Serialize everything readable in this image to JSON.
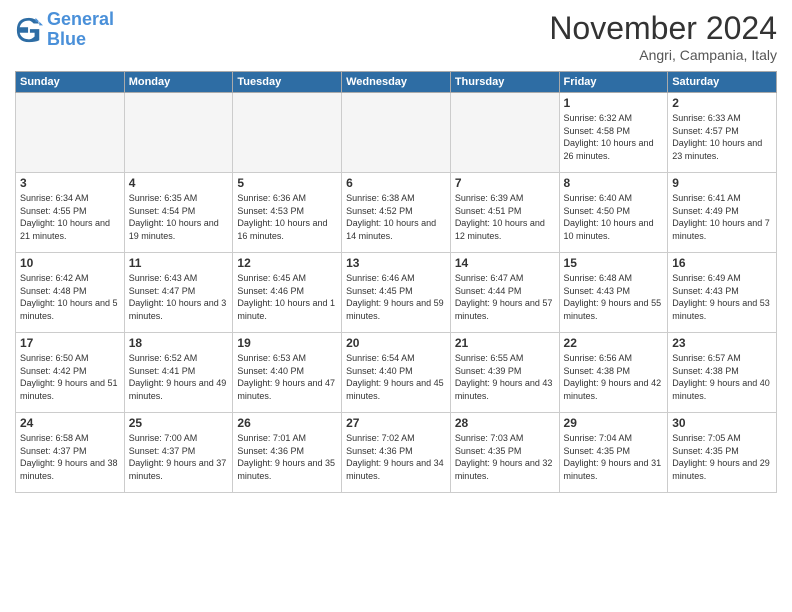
{
  "header": {
    "logo_general": "General",
    "logo_blue": "Blue",
    "month_title": "November 2024",
    "location": "Angri, Campania, Italy"
  },
  "weekdays": [
    "Sunday",
    "Monday",
    "Tuesday",
    "Wednesday",
    "Thursday",
    "Friday",
    "Saturday"
  ],
  "weeks": [
    [
      {
        "day": "",
        "info": "",
        "empty": true
      },
      {
        "day": "",
        "info": "",
        "empty": true
      },
      {
        "day": "",
        "info": "",
        "empty": true
      },
      {
        "day": "",
        "info": "",
        "empty": true
      },
      {
        "day": "",
        "info": "",
        "empty": true
      },
      {
        "day": "1",
        "info": "Sunrise: 6:32 AM\nSunset: 4:58 PM\nDaylight: 10 hours and 26 minutes."
      },
      {
        "day": "2",
        "info": "Sunrise: 6:33 AM\nSunset: 4:57 PM\nDaylight: 10 hours and 23 minutes."
      }
    ],
    [
      {
        "day": "3",
        "info": "Sunrise: 6:34 AM\nSunset: 4:55 PM\nDaylight: 10 hours and 21 minutes."
      },
      {
        "day": "4",
        "info": "Sunrise: 6:35 AM\nSunset: 4:54 PM\nDaylight: 10 hours and 19 minutes."
      },
      {
        "day": "5",
        "info": "Sunrise: 6:36 AM\nSunset: 4:53 PM\nDaylight: 10 hours and 16 minutes."
      },
      {
        "day": "6",
        "info": "Sunrise: 6:38 AM\nSunset: 4:52 PM\nDaylight: 10 hours and 14 minutes."
      },
      {
        "day": "7",
        "info": "Sunrise: 6:39 AM\nSunset: 4:51 PM\nDaylight: 10 hours and 12 minutes."
      },
      {
        "day": "8",
        "info": "Sunrise: 6:40 AM\nSunset: 4:50 PM\nDaylight: 10 hours and 10 minutes."
      },
      {
        "day": "9",
        "info": "Sunrise: 6:41 AM\nSunset: 4:49 PM\nDaylight: 10 hours and 7 minutes."
      }
    ],
    [
      {
        "day": "10",
        "info": "Sunrise: 6:42 AM\nSunset: 4:48 PM\nDaylight: 10 hours and 5 minutes."
      },
      {
        "day": "11",
        "info": "Sunrise: 6:43 AM\nSunset: 4:47 PM\nDaylight: 10 hours and 3 minutes."
      },
      {
        "day": "12",
        "info": "Sunrise: 6:45 AM\nSunset: 4:46 PM\nDaylight: 10 hours and 1 minute."
      },
      {
        "day": "13",
        "info": "Sunrise: 6:46 AM\nSunset: 4:45 PM\nDaylight: 9 hours and 59 minutes."
      },
      {
        "day": "14",
        "info": "Sunrise: 6:47 AM\nSunset: 4:44 PM\nDaylight: 9 hours and 57 minutes."
      },
      {
        "day": "15",
        "info": "Sunrise: 6:48 AM\nSunset: 4:43 PM\nDaylight: 9 hours and 55 minutes."
      },
      {
        "day": "16",
        "info": "Sunrise: 6:49 AM\nSunset: 4:43 PM\nDaylight: 9 hours and 53 minutes."
      }
    ],
    [
      {
        "day": "17",
        "info": "Sunrise: 6:50 AM\nSunset: 4:42 PM\nDaylight: 9 hours and 51 minutes."
      },
      {
        "day": "18",
        "info": "Sunrise: 6:52 AM\nSunset: 4:41 PM\nDaylight: 9 hours and 49 minutes."
      },
      {
        "day": "19",
        "info": "Sunrise: 6:53 AM\nSunset: 4:40 PM\nDaylight: 9 hours and 47 minutes."
      },
      {
        "day": "20",
        "info": "Sunrise: 6:54 AM\nSunset: 4:40 PM\nDaylight: 9 hours and 45 minutes."
      },
      {
        "day": "21",
        "info": "Sunrise: 6:55 AM\nSunset: 4:39 PM\nDaylight: 9 hours and 43 minutes."
      },
      {
        "day": "22",
        "info": "Sunrise: 6:56 AM\nSunset: 4:38 PM\nDaylight: 9 hours and 42 minutes."
      },
      {
        "day": "23",
        "info": "Sunrise: 6:57 AM\nSunset: 4:38 PM\nDaylight: 9 hours and 40 minutes."
      }
    ],
    [
      {
        "day": "24",
        "info": "Sunrise: 6:58 AM\nSunset: 4:37 PM\nDaylight: 9 hours and 38 minutes."
      },
      {
        "day": "25",
        "info": "Sunrise: 7:00 AM\nSunset: 4:37 PM\nDaylight: 9 hours and 37 minutes."
      },
      {
        "day": "26",
        "info": "Sunrise: 7:01 AM\nSunset: 4:36 PM\nDaylight: 9 hours and 35 minutes."
      },
      {
        "day": "27",
        "info": "Sunrise: 7:02 AM\nSunset: 4:36 PM\nDaylight: 9 hours and 34 minutes."
      },
      {
        "day": "28",
        "info": "Sunrise: 7:03 AM\nSunset: 4:35 PM\nDaylight: 9 hours and 32 minutes."
      },
      {
        "day": "29",
        "info": "Sunrise: 7:04 AM\nSunset: 4:35 PM\nDaylight: 9 hours and 31 minutes."
      },
      {
        "day": "30",
        "info": "Sunrise: 7:05 AM\nSunset: 4:35 PM\nDaylight: 9 hours and 29 minutes."
      }
    ]
  ]
}
